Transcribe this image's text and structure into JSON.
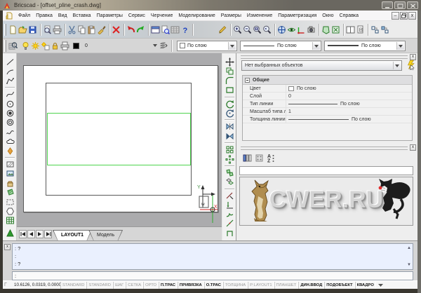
{
  "window": {
    "title": "Bricscad - [offset_pline_crash.dwg]"
  },
  "menu": {
    "items": [
      "Файл",
      "Правка",
      "Вид",
      "Вставка",
      "Параметры",
      "Сервис",
      "Черчение",
      "Моделирование",
      "Размеры",
      "Изменение",
      "Параметризация",
      "Окно",
      "Справка"
    ]
  },
  "toolbar_main": {
    "icons": [
      "new",
      "open",
      "save",
      "|",
      "print-preview",
      "print",
      "|",
      "cut",
      "copy",
      "paste",
      "match-properties",
      "|",
      "delete",
      "|",
      "undo",
      "redo",
      "|",
      "panels",
      "find",
      "drawing-explorer",
      "help",
      "gap",
      "redline",
      "|",
      "zoom-in",
      "zoom-out",
      "zoom-window",
      "zoom-previous",
      "|",
      "pan",
      "view",
      "axes",
      "named-views",
      "|",
      "ucs",
      "view-rotate",
      "|",
      "viewports",
      "sheet",
      "|",
      "link",
      "publish"
    ]
  },
  "toolbar_entity": {
    "explorer_icon": "layers-explorer",
    "layer_icons": [
      "bulb",
      "sun",
      "freeze",
      "lock",
      "plot"
    ],
    "layer_value": "0",
    "stack_icon": "layer-states",
    "color_value": "По слою",
    "linetype_value": "По слою",
    "lineweight_value": "По слою"
  },
  "left_toolbar": {
    "icons": [
      "line",
      "arc",
      "polyline",
      "|",
      "spline",
      "circle",
      "donut",
      "concentric",
      "sketch",
      "cloud",
      "point",
      "|",
      "region",
      "image",
      "block",
      "hatch",
      "boundary",
      "polygon",
      "table"
    ],
    "bottom_icon": "text"
  },
  "right_toolbar": {
    "icons": [
      "move",
      "copy-object",
      "fillet",
      "rectangle",
      "|",
      "rotate",
      "rotate-3d",
      "|",
      "mirror",
      "mirror-3d",
      "|",
      "array",
      "array-polar",
      "|",
      "copy-nested",
      "offset",
      "|",
      "trim",
      "extend",
      "break",
      "join",
      "pedit"
    ]
  },
  "canvas": {
    "ucs": {
      "x_label": "X",
      "y_label": "Y",
      "w_label": "W"
    }
  },
  "tabs": {
    "nav": [
      "first",
      "prev",
      "next",
      "last"
    ],
    "items": [
      {
        "label": "LAYOUT1",
        "active": true
      },
      {
        "label": "Модель",
        "active": false
      }
    ]
  },
  "properties_panel": {
    "selector": "Нет выбранных объектов",
    "section": "Общие",
    "rows": [
      {
        "label": "Цвет",
        "value": "По слою",
        "swatch": true
      },
      {
        "label": "Слой",
        "value": "0"
      },
      {
        "label": "Тип линии",
        "value": "По слою",
        "line": 70
      },
      {
        "label": "Масштаб типа л",
        "value": "1"
      },
      {
        "label": "Толщина линии",
        "value": "По слою",
        "line": 86
      }
    ]
  },
  "panel2": {
    "icons": [
      "columns",
      "settings",
      "sort-az"
    ],
    "watermark": "CWER.RU"
  },
  "command": {
    "history": [
      ": ?",
      ":",
      ": ?"
    ],
    "prompt": ":"
  },
  "status": {
    "left": "Г",
    "coords": "10.6126, 0.0319, 0.0000",
    "cells": [
      {
        "label": "STANDARD",
        "on": false
      },
      {
        "label": "STANDARD",
        "on": false
      },
      {
        "label": "ШАГ",
        "on": false
      },
      {
        "label": "СЕТКА",
        "on": false
      },
      {
        "label": "ОРТО",
        "on": false
      },
      {
        "label": "П.ТРАС",
        "on": true
      },
      {
        "label": "ПРИВЯЗКА",
        "on": true
      },
      {
        "label": "О.ТРАС",
        "on": true
      },
      {
        "label": "ТОЛЩИНА",
        "on": false
      },
      {
        "label": "P:LAYOUT1",
        "on": false
      },
      {
        "label": "ПЛАНШЕТ",
        "on": false
      },
      {
        "label": "ДИН.ВВОД",
        "on": true
      },
      {
        "label": "ПОДОБЪЕКТ",
        "on": true
      },
      {
        "label": "КВАДРО",
        "on": true
      }
    ]
  }
}
